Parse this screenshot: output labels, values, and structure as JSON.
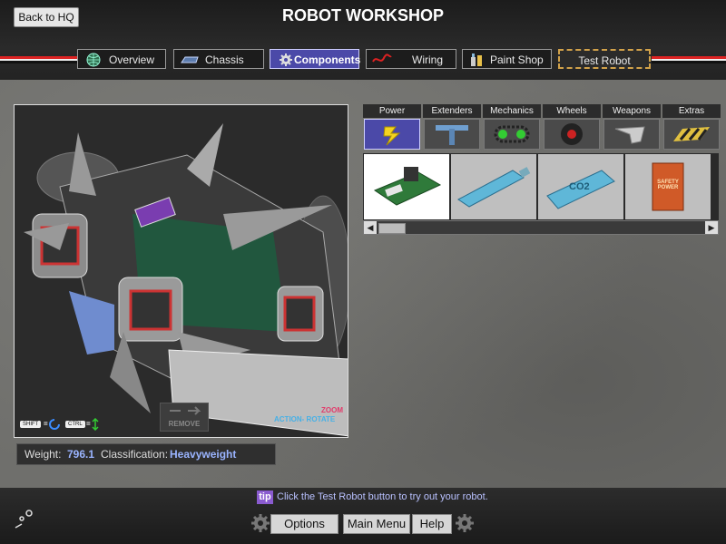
{
  "header": {
    "back_label": "Back to HQ",
    "title": "ROBOT WORKSHOP"
  },
  "tabs": [
    {
      "label": "Overview",
      "icon": "globe-icon"
    },
    {
      "label": "Chassis",
      "icon": "chassis-icon"
    },
    {
      "label": "Components",
      "icon": "gear-icon",
      "active": true
    },
    {
      "label": "Wiring",
      "icon": "wire-icon"
    },
    {
      "label": "Paint Shop",
      "icon": "paint-can-icon"
    },
    {
      "label": "Test Robot",
      "icon": ""
    }
  ],
  "viewport": {
    "remove_label": "REMOVE",
    "shift_key": "SHIFT",
    "ctrl_key": "CTRL",
    "zoom_label": "ZOOM",
    "action_rotate_label": "ACTION- ROTATE"
  },
  "stats": {
    "weight_label": "Weight:",
    "weight_value": "796.1",
    "class_label": "Classification:",
    "class_value": "Heavyweight"
  },
  "categories": [
    {
      "name": "Power",
      "icon": "lightning-icon",
      "active": true
    },
    {
      "name": "Extenders",
      "icon": "beam-icon"
    },
    {
      "name": "Mechanics",
      "icon": "chain-icon"
    },
    {
      "name": "Wheels",
      "icon": "wheel-icon"
    },
    {
      "name": "Weapons",
      "icon": "plow-icon"
    },
    {
      "name": "Extras",
      "icon": "hazard-plate-icon"
    }
  ],
  "parts": [
    {
      "name": "circuit-board",
      "selected": true
    },
    {
      "name": "tank-blue"
    },
    {
      "name": "tank-co2",
      "text": "CO2"
    },
    {
      "name": "safety-power-box",
      "text": "SAFETY POWER"
    }
  ],
  "tip": {
    "badge": "tip",
    "text": "Click the Test Robot button to try out your robot."
  },
  "footer": {
    "options_label": "Options",
    "main_menu_label": "Main Menu",
    "help_label": "Help"
  },
  "colors": {
    "accent": "#4b49a8",
    "stat_value": "#9ab4ff",
    "tip_text": "#b9c1ff",
    "tip_badge": "#8a5bcf",
    "test_border": "#d2a24a"
  }
}
